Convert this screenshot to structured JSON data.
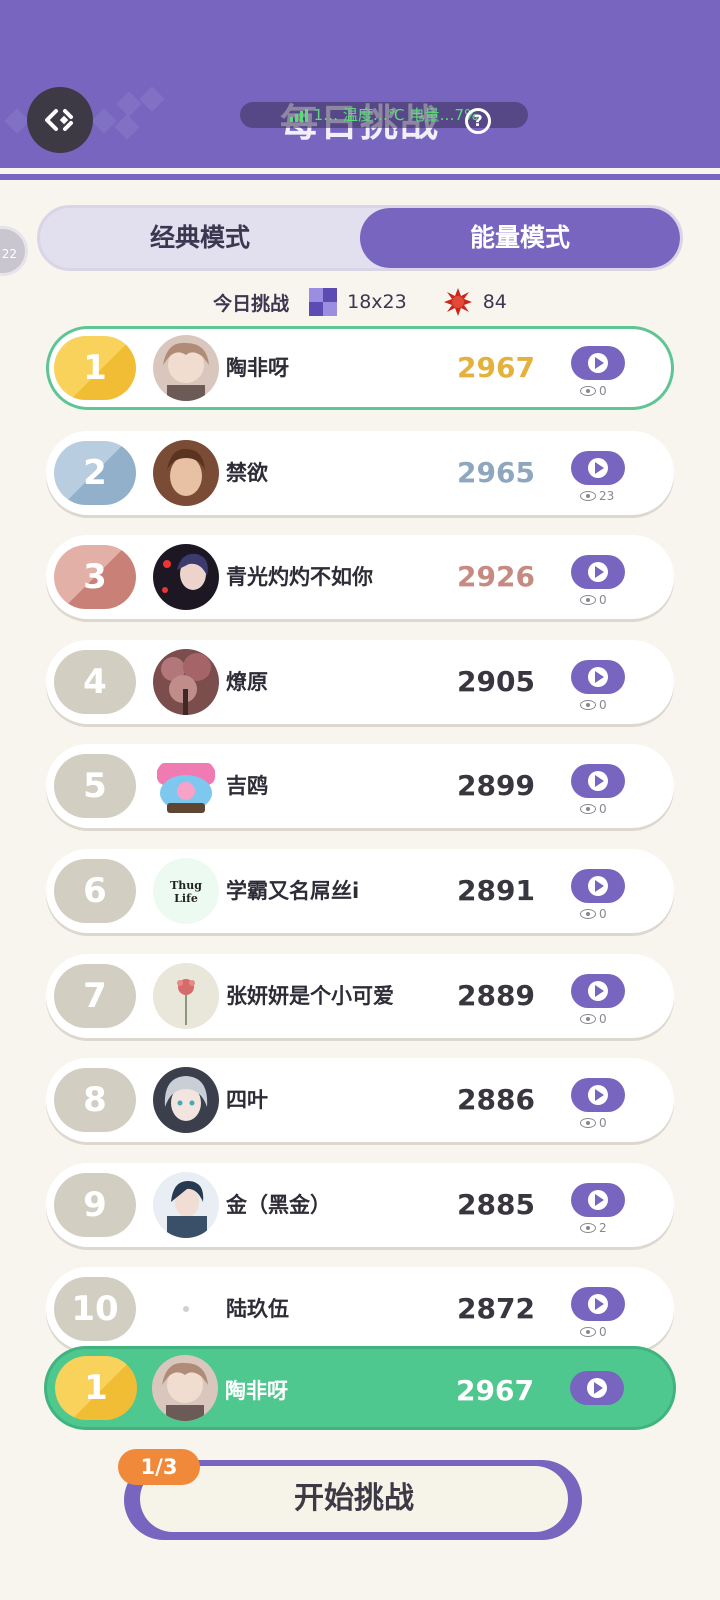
{
  "header": {
    "title": "每日挑战",
    "help_symbol": "?",
    "status": "1… 温度…℃ 电量…7%"
  },
  "side_badge_text": "22",
  "mode_tabs": [
    {
      "label": "经典模式",
      "active": false
    },
    {
      "label": "能量模式",
      "active": true
    }
  ],
  "challenge": {
    "label": "今日挑战",
    "grid_size": "18x23",
    "energy": "84"
  },
  "colors": {
    "accent": "#7765bf",
    "gold": "#f5c542",
    "silver": "#9ab4cc",
    "bronze": "#cf8e86",
    "gray": "#d2cec2",
    "green": "#4fc88f",
    "orange": "#f08a3a"
  },
  "leaderboard": [
    {
      "rank": "1",
      "name": "陶非呀",
      "score": "2967",
      "views": "0",
      "avatar": "anime-girl-avatar"
    },
    {
      "rank": "2",
      "name": "禁欲",
      "score": "2965",
      "views": "23",
      "avatar": "portrait-avatar"
    },
    {
      "rank": "3",
      "name": "青光灼灼不如你",
      "score": "2926",
      "views": "0",
      "avatar": "anime-boy-avatar"
    },
    {
      "rank": "4",
      "name": "燎原",
      "score": "2905",
      "views": "0",
      "avatar": "blossom-tree-avatar"
    },
    {
      "rank": "5",
      "name": "吉鸥",
      "score": "2899",
      "views": "0",
      "avatar": "kirby-logo-avatar"
    },
    {
      "rank": "6",
      "name": "学霸又名屌丝i",
      "score": "2891",
      "views": "0",
      "avatar": "thug-life-avatar"
    },
    {
      "rank": "7",
      "name": "张妍妍是个小可爱",
      "score": "2889",
      "views": "0",
      "avatar": "flower-avatar"
    },
    {
      "rank": "8",
      "name": "四叶",
      "score": "2886",
      "views": "0",
      "avatar": "anime-silver-hair-avatar"
    },
    {
      "rank": "9",
      "name": "金（黑金）",
      "score": "2885",
      "views": "2",
      "avatar": "anime-warrior-avatar"
    },
    {
      "rank": "10",
      "name": "陆玖伍",
      "score": "2872",
      "views": "0",
      "avatar": "blank-avatar"
    }
  ],
  "my_rank": {
    "rank": "1",
    "name": "陶非呀",
    "score": "2967"
  },
  "start": {
    "label": "开始挑战",
    "attempts": "1/3"
  }
}
